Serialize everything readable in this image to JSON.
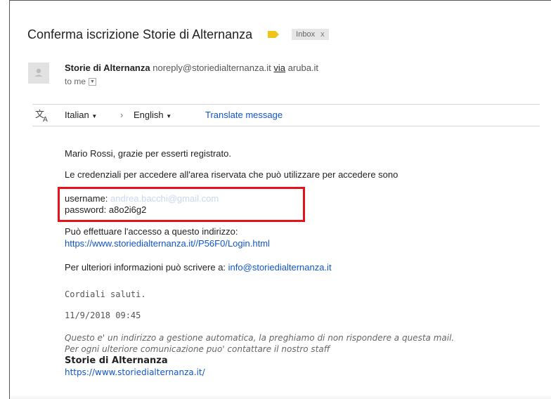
{
  "subject": "Conferma iscrizione Storie di Alternanza",
  "label": {
    "name": "Inbox",
    "close": "x",
    "tag_color": "#f0c419"
  },
  "sender": {
    "name": "Storie di Alternanza",
    "email": "noreply@storiedialternanza.it",
    "via_label": "via",
    "via_domain": "aruba.it",
    "to": "to me"
  },
  "translate": {
    "from": "Italian",
    "arrow": "›",
    "to": "English",
    "action": "Translate message"
  },
  "message": {
    "greeting": "Mario Rossi, grazie per esserti registrato.",
    "intro": "Le credenziali per accedere all'area riservata che può utilizzare per accedere sono",
    "username_label": "username:",
    "username_value": "andrea.bacchi@gmail.com",
    "password_label": "password:",
    "password_value": "a8o2i6g2",
    "access_text": "Può effettuare l'accesso a questo indirizzo:",
    "access_link": "https://www.storiedialternanza.it//P56F0/Login.html",
    "info_text": "Per ulteriori informazioni può scrivere a:",
    "info_email": "info@storiedialternanza.it",
    "closing": "Cordiali saluti.",
    "datetime": "11/9/2018 09:45",
    "notice_line1": "Questo e' un indirizzo a gestione automatica, la preghiamo di non rispondere a questa mail.",
    "notice_line2": "Per ogni ulteriore comunicazione puo' contattare il nostro staff",
    "signature_name": "Storie di Alternanza",
    "signature_link": "https://www.storiedialternanza.it/"
  },
  "icons": {
    "avatar": "person-avatar-icon",
    "translate": "translate-icon",
    "to_dropdown": "chevron-down-icon",
    "lang_dropdown": "caret-down-icon"
  },
  "colors": {
    "link": "#1155cc",
    "highlight_box": "#e3121b"
  }
}
